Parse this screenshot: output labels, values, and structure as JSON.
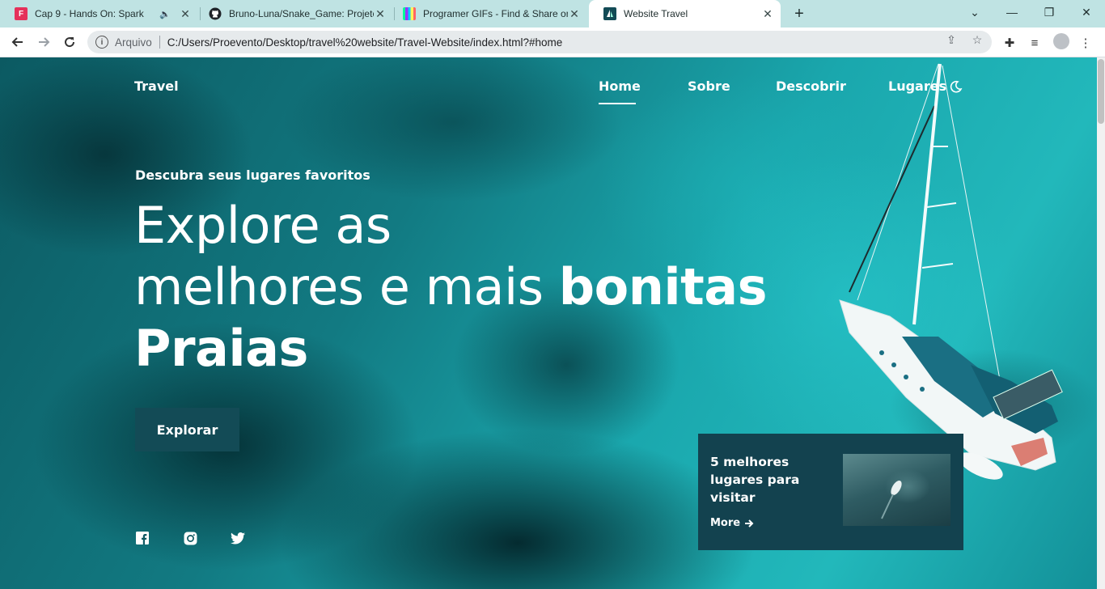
{
  "browser": {
    "tabs": [
      {
        "title": "Cap 9 - Hands On: Spark",
        "favicon": "flipsnack-icon",
        "muted": true
      },
      {
        "title": "Bruno-Luna/Snake_Game: Projeto",
        "favicon": "github-icon"
      },
      {
        "title": "Programer GIFs - Find & Share on",
        "favicon": "giphy-icon"
      },
      {
        "title": "Website Travel",
        "favicon": "sail-icon",
        "active": true
      }
    ],
    "address": {
      "scheme_label": "Arquivo",
      "url": "C:/Users/Proevento/Desktop/travel%20website/Travel-Website/index.html?#home"
    }
  },
  "site": {
    "logo": "Travel",
    "nav": [
      "Home",
      "Sobre",
      "Descobrir",
      "Lugares"
    ],
    "active_nav": "Home",
    "hero": {
      "subtitle": "Descubra seus lugares favoritos",
      "line1": "Explore as",
      "line2_regular": "melhores e mais ",
      "line2_bold": "bonitas",
      "line3_bold": "Praias",
      "button": "Explorar"
    },
    "social": [
      "facebook-icon",
      "instagram-icon",
      "twitter-icon"
    ],
    "card": {
      "title": "5 melhores lugares para visitar",
      "more": "More"
    }
  },
  "colors": {
    "tabbar": "#bfe3e3",
    "button_bg": "#134b56",
    "card_bg": "#13424f",
    "sea": "#1aa7ad"
  }
}
